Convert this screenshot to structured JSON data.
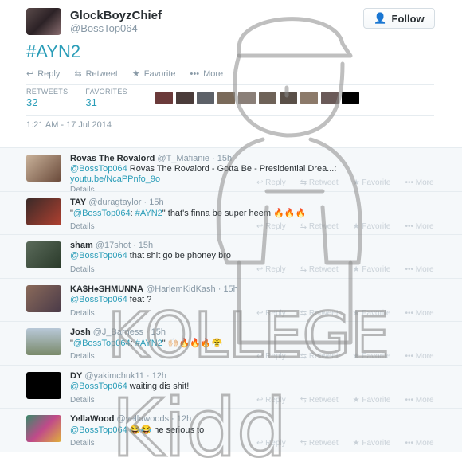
{
  "tweet": {
    "display_name": "GlockBoyzChief",
    "handle": "@BossTop064",
    "follow_label": "Follow",
    "text": "#AYN2",
    "actions": {
      "reply": "Reply",
      "retweet": "Retweet",
      "favorite": "Favorite",
      "more": "More"
    },
    "stats": {
      "retweets_label": "RETWEETS",
      "retweets": "32",
      "favorites_label": "FAVORITES",
      "favorites": "31"
    },
    "timestamp": "1:21 AM - 17 Jul 2014"
  },
  "replies": [
    {
      "name": "Rovas The Rovalord",
      "handle": "@T_Mafianie · 15h",
      "mention": "@BossTop064",
      "text": " Rovas The Rovalord - Gotta Be - Presidential Drea...:",
      "link": "youtu.be/NcaPPnfo_9o",
      "details": "Details"
    },
    {
      "name": "TAY",
      "handle": "@duragtaylor · 15h",
      "prefix": "\"",
      "mention": "@BossTop064",
      "mid": ": ",
      "mention2": "#AYN2",
      "text": "\" that's finna be super heem 🔥🔥🔥",
      "details": "Details"
    },
    {
      "name": "sham",
      "handle": "@17shot · 15h",
      "mention": "@BossTop064",
      "text": " that shit go be phoney bro",
      "details": "Details"
    },
    {
      "name": "KA$H♠SHMUNNA",
      "handle": "@HarlemKidKash · 15h",
      "mention": "@BossTop064",
      "text": " feat ?",
      "details": "Details"
    },
    {
      "name": "Josh",
      "handle": "@J_Barness · 15h",
      "prefix": "\"",
      "mention": "@BossTop064",
      "mid": ": ",
      "mention2": "#AYN2",
      "text": "\" 🙌🏻🔥🔥🔥😤",
      "details": "Details"
    },
    {
      "name": "DY",
      "handle": "@yakimchuk11 · 12h",
      "mention": "@BossTop064",
      "text": " waiting dis shit!",
      "details": "Details"
    },
    {
      "name": "YellaWood",
      "handle": "@yellawoods · 12h",
      "mention": "@BossTop064",
      "text": " 😂😂 he serious to",
      "details": "Details"
    }
  ],
  "reply_actions": {
    "reply": "Reply",
    "retweet": "Retweet",
    "favorite": "Favorite",
    "more": "More"
  },
  "watermark": {
    "line1": "KOLLEGE",
    "line2": "Kidd"
  },
  "colors": {
    "link": "#2a9db8",
    "muted": "#8899a6",
    "text": "#292f33",
    "follow_icon": "#55acee"
  }
}
